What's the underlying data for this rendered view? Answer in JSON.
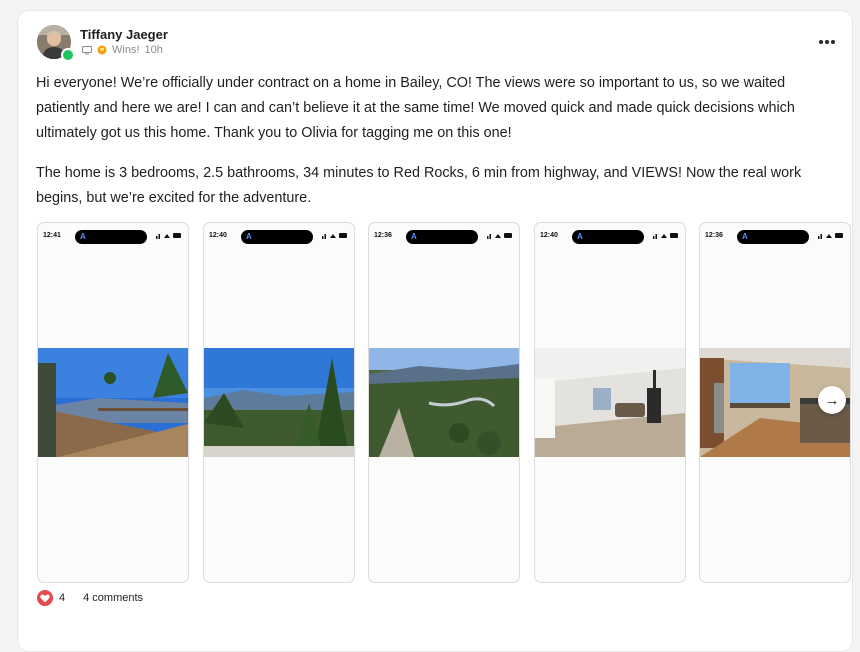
{
  "post": {
    "author": "Tiffany Jaeger",
    "category": "Wins!",
    "time": "10h",
    "paragraphs": [
      "Hi everyone! We’re officially under contract on a home in Bailey, CO! The views were so important to us, so we waited patiently and here we are! I can and can’t believe it at the same time! We moved quick and made quick decisions which ultimately got us this home. Thank you to Olivia for tagging me on this one!",
      "The home is 3 bedrooms, 2.5 bathrooms, 34 minutes to Red Rocks, 6 min from highway, and VIEWS! Now the real work begins, but we’re excited for the adventure."
    ],
    "reactions": "4",
    "comments": "4 comments"
  },
  "gallery": [
    {
      "time": "12:41",
      "scene": "deck-with-mountain-view"
    },
    {
      "time": "12:40",
      "scene": "pine-trees-mountain-view"
    },
    {
      "time": "12:36",
      "scene": "aerial-forest-valley"
    },
    {
      "time": "12:40",
      "scene": "living-room-interior"
    },
    {
      "time": "12:36",
      "scene": "kitchen-interior"
    }
  ],
  "colors": {
    "accent_heart": "#e5484d",
    "online": "#22c55e"
  },
  "icons": {
    "more": "more-horizontal-icon",
    "next": "arrow-right-icon"
  }
}
